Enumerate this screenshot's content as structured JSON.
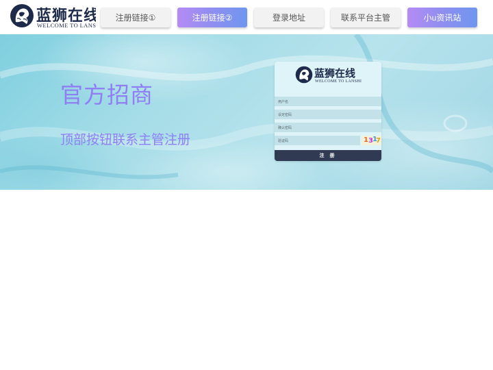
{
  "brand": {
    "name": "蓝狮在线",
    "tagline": "WELCOME TO LANSHI"
  },
  "nav": {
    "items": [
      {
        "label": "注册链接①",
        "style": "plain"
      },
      {
        "label": "注册链接②",
        "style": "gradient"
      },
      {
        "label": "登录地址",
        "style": "plain"
      },
      {
        "label": "联系平台主管",
        "style": "plain"
      },
      {
        "label": "小u资讯站",
        "style": "gradient"
      }
    ]
  },
  "hero": {
    "title": "官方招商",
    "subtitle": "顶部按钮联系主管注册"
  },
  "form": {
    "username_placeholder": "用户名",
    "password_placeholder": "设定密码",
    "confirm_placeholder": "确认密码",
    "captcha_placeholder": "验证码",
    "captcha_chars": [
      "1",
      "3",
      "1",
      "7"
    ],
    "submit_label": "注 册"
  },
  "colors": {
    "accent_purple": "#8f7ff2",
    "nav_gradient_start": "#b48bf5",
    "nav_gradient_end": "#6f96ef",
    "brand_navy": "#1e2a4a",
    "submit_bg": "#303a52",
    "hero_bg": "#a6dde8"
  },
  "icons": {
    "logo": "lion-head-icon"
  }
}
